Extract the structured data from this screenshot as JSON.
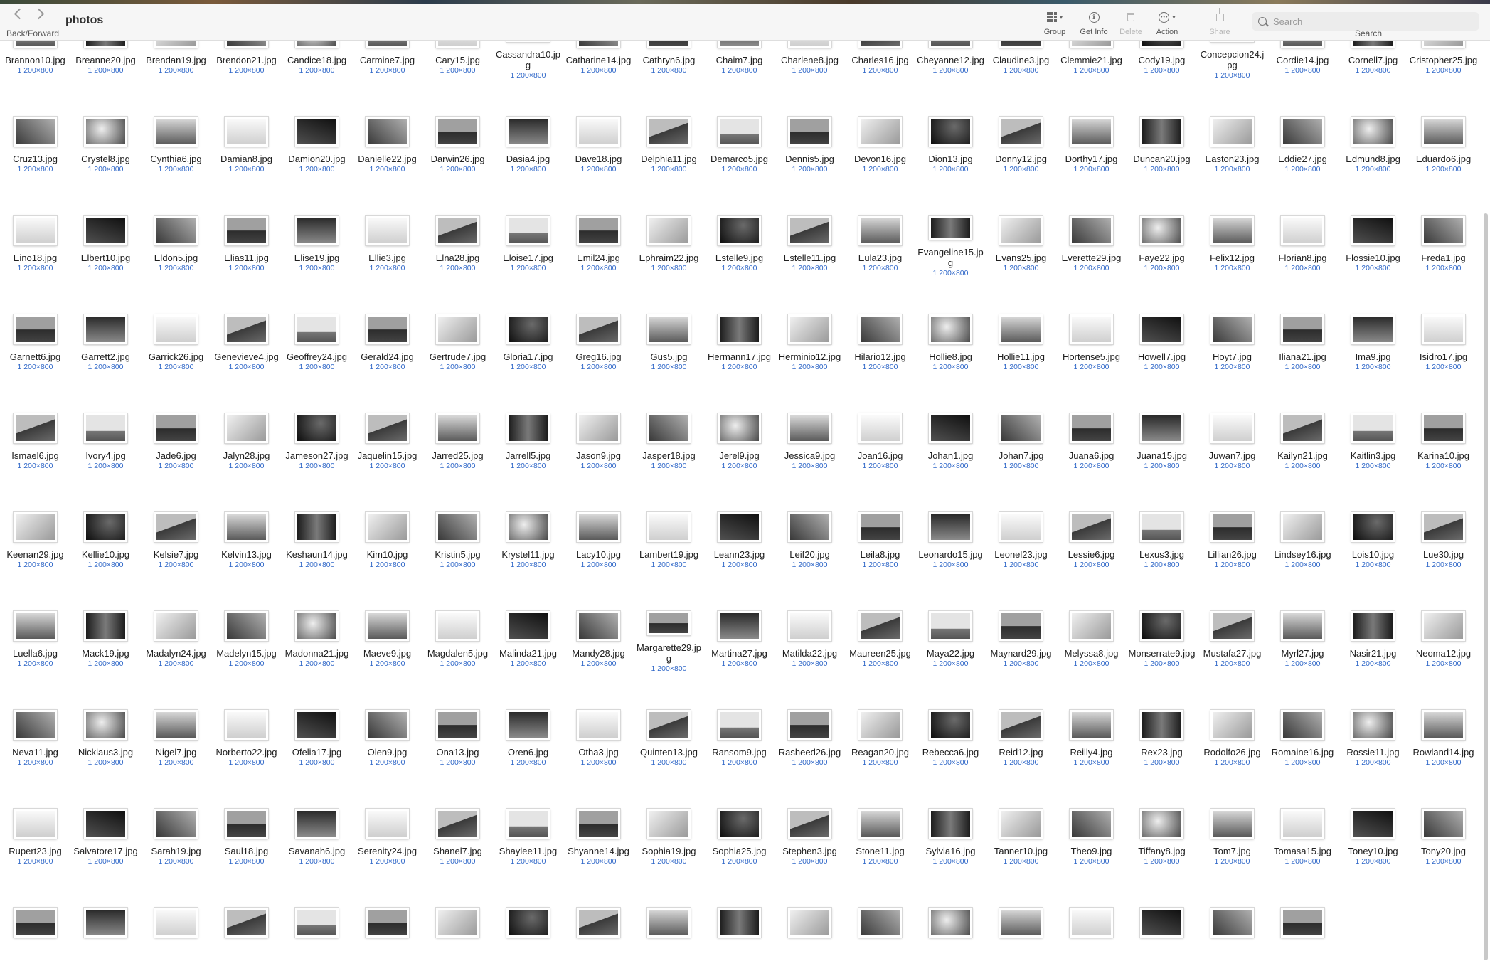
{
  "window": {
    "title": "photos",
    "nav_label": "Back/Forward"
  },
  "toolbar": {
    "group_label": "Group",
    "getinfo_label": "Get Info",
    "delete_label": "Delete",
    "action_label": "Action",
    "share_label": "Share",
    "search_placeholder": "Search",
    "search_label": "Search"
  },
  "dimensions": "1 200×800",
  "files": [
    "Brannon10.jpg",
    "Breanne20.jpg",
    "Brendan19.jpg",
    "Brendon21.jpg",
    "Candice18.jpg",
    "Carmine7.jpg",
    "Cary15.jpg",
    "Cassandra10.jpg",
    "Catharine14.jpg",
    "Cathryn6.jpg",
    "Chaim7.jpg",
    "Charlene8.jpg",
    "Charles16.jpg",
    "Cheyanne12.jpg",
    "Claudine3.jpg",
    "Clemmie21.jpg",
    "Cody19.jpg",
    "Concepcion24.jpg",
    "Cordie14.jpg",
    "Cornell7.jpg",
    "Cristopher25.jpg",
    "Cruz13.jpg",
    "Crystel8.jpg",
    "Cynthia6.jpg",
    "Damian8.jpg",
    "Damion20.jpg",
    "Danielle22.jpg",
    "Darwin26.jpg",
    "Dasia4.jpg",
    "Dave18.jpg",
    "Delphia11.jpg",
    "Demarco5.jpg",
    "Dennis5.jpg",
    "Devon16.jpg",
    "Dion13.jpg",
    "Donny12.jpg",
    "Dorthy17.jpg",
    "Duncan20.jpg",
    "Easton23.jpg",
    "Eddie27.jpg",
    "Edmund8.jpg",
    "Eduardo6.jpg",
    "Eino18.jpg",
    "Elbert10.jpg",
    "Eldon5.jpg",
    "Elias11.jpg",
    "Elise19.jpg",
    "Ellie3.jpg",
    "Elna28.jpg",
    "Eloise17.jpg",
    "Emil24.jpg",
    "Ephraim22.jpg",
    "Estelle9.jpg",
    "Estelle11.jpg",
    "Eula23.jpg",
    "Evangeline15.jpg",
    "Evans25.jpg",
    "Everette29.jpg",
    "Faye22.jpg",
    "Felix12.jpg",
    "Florian8.jpg",
    "Flossie10.jpg",
    "Freda1.jpg",
    "Garnett6.jpg",
    "Garrett2.jpg",
    "Garrick26.jpg",
    "Genevieve4.jpg",
    "Geoffrey24.jpg",
    "Gerald24.jpg",
    "Gertrude7.jpg",
    "Gloria17.jpg",
    "Greg16.jpg",
    "Gus5.jpg",
    "Hermann17.jpg",
    "Herminio12.jpg",
    "Hilario12.jpg",
    "Hollie8.jpg",
    "Hollie11.jpg",
    "Hortense5.jpg",
    "Howell7.jpg",
    "Hoyt7.jpg",
    "Iliana21.jpg",
    "Ima9.jpg",
    "Isidro17.jpg",
    "Ismael6.jpg",
    "Ivory4.jpg",
    "Jade6.jpg",
    "Jalyn28.jpg",
    "Jameson27.jpg",
    "Jaquelin15.jpg",
    "Jarred25.jpg",
    "Jarrell5.jpg",
    "Jason9.jpg",
    "Jasper18.jpg",
    "Jerel9.jpg",
    "Jessica9.jpg",
    "Joan16.jpg",
    "Johan1.jpg",
    "Johan7.jpg",
    "Juana6.jpg",
    "Juana15.jpg",
    "Juwan7.jpg",
    "Kailyn21.jpg",
    "Kaitlin3.jpg",
    "Karina10.jpg",
    "Keenan29.jpg",
    "Kellie10.jpg",
    "Kelsie7.jpg",
    "Kelvin13.jpg",
    "Keshaun14.jpg",
    "Kim10.jpg",
    "Kristin5.jpg",
    "Krystel11.jpg",
    "Lacy10.jpg",
    "Lambert19.jpg",
    "Leann23.jpg",
    "Leif20.jpg",
    "Leila8.jpg",
    "Leonardo15.jpg",
    "Leonel23.jpg",
    "Lessie6.jpg",
    "Lexus3.jpg",
    "Lillian26.jpg",
    "Lindsey16.jpg",
    "Lois10.jpg",
    "Lue30.jpg",
    "Luella6.jpg",
    "Mack19.jpg",
    "Madalyn24.jpg",
    "Madelyn15.jpg",
    "Madonna21.jpg",
    "Maeve9.jpg",
    "Magdalen5.jpg",
    "Malinda21.jpg",
    "Mandy28.jpg",
    "Margarette29.jpg",
    "Martina27.jpg",
    "Matilda22.jpg",
    "Maureen25.jpg",
    "Maya22.jpg",
    "Maynard29.jpg",
    "Melyssa8.jpg",
    "Monserrate9.jpg",
    "Mustafa27.jpg",
    "Myrl27.jpg",
    "Nasir21.jpg",
    "Neoma12.jpg",
    "Neva11.jpg",
    "Nicklaus3.jpg",
    "Nigel7.jpg",
    "Norberto22.jpg",
    "Ofelia17.jpg",
    "Olen9.jpg",
    "Ona13.jpg",
    "Oren6.jpg",
    "Otha3.jpg",
    "Quinten13.jpg",
    "Ransom9.jpg",
    "Rasheed26.jpg",
    "Reagan20.jpg",
    "Rebecca6.jpg",
    "Reid12.jpg",
    "Reilly4.jpg",
    "Rex23.jpg",
    "Rodolfo26.jpg",
    "Romaine16.jpg",
    "Rossie11.jpg",
    "Rowland14.jpg",
    "Rupert23.jpg",
    "Salvatore17.jpg",
    "Sarah19.jpg",
    "Saul18.jpg",
    "Savanah6.jpg",
    "Serenity24.jpg",
    "Shanel7.jpg",
    "Shaylee11.jpg",
    "Shyanne14.jpg",
    "Sophia19.jpg",
    "Sophia25.jpg",
    "Stephen3.jpg",
    "Stone11.jpg",
    "Sylvia16.jpg",
    "Tanner10.jpg",
    "Theo9.jpg",
    "Tiffany8.jpg",
    "Tom7.jpg",
    "Tomasa15.jpg",
    "Toney10.jpg",
    "Tony20.jpg",
    "",
    "",
    "",
    "",
    "",
    "",
    "",
    "",
    "",
    "",
    "",
    "",
    "",
    "",
    "",
    "",
    "",
    "",
    ""
  ]
}
